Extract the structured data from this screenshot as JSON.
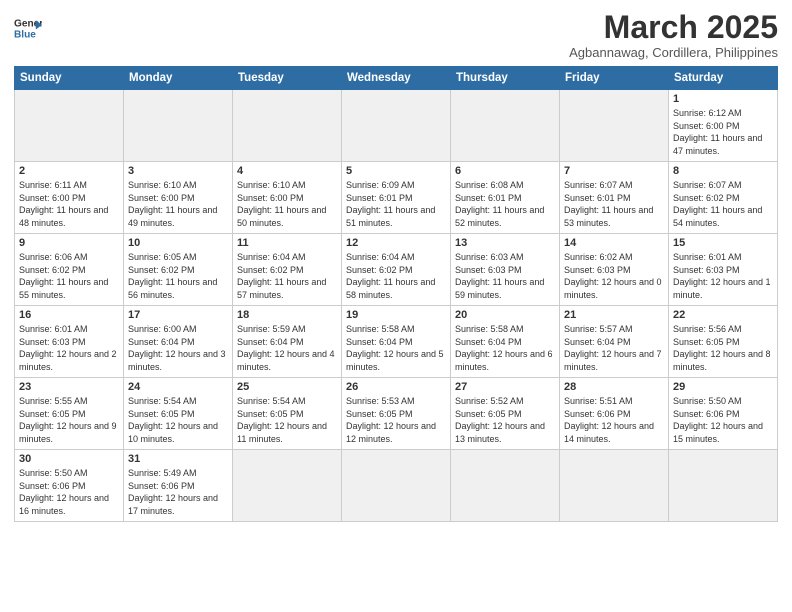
{
  "logo": {
    "line1": "General",
    "line2": "Blue"
  },
  "title": "March 2025",
  "subtitle": "Agbannawag, Cordillera, Philippines",
  "days_of_week": [
    "Sunday",
    "Monday",
    "Tuesday",
    "Wednesday",
    "Thursday",
    "Friday",
    "Saturday"
  ],
  "weeks": [
    [
      {
        "day": "",
        "info": ""
      },
      {
        "day": "",
        "info": ""
      },
      {
        "day": "",
        "info": ""
      },
      {
        "day": "",
        "info": ""
      },
      {
        "day": "",
        "info": ""
      },
      {
        "day": "",
        "info": ""
      },
      {
        "day": "1",
        "info": "Sunrise: 6:12 AM\nSunset: 6:00 PM\nDaylight: 11 hours and 47 minutes."
      }
    ],
    [
      {
        "day": "2",
        "info": "Sunrise: 6:11 AM\nSunset: 6:00 PM\nDaylight: 11 hours and 48 minutes."
      },
      {
        "day": "3",
        "info": "Sunrise: 6:10 AM\nSunset: 6:00 PM\nDaylight: 11 hours and 49 minutes."
      },
      {
        "day": "4",
        "info": "Sunrise: 6:10 AM\nSunset: 6:00 PM\nDaylight: 11 hours and 50 minutes."
      },
      {
        "day": "5",
        "info": "Sunrise: 6:09 AM\nSunset: 6:01 PM\nDaylight: 11 hours and 51 minutes."
      },
      {
        "day": "6",
        "info": "Sunrise: 6:08 AM\nSunset: 6:01 PM\nDaylight: 11 hours and 52 minutes."
      },
      {
        "day": "7",
        "info": "Sunrise: 6:07 AM\nSunset: 6:01 PM\nDaylight: 11 hours and 53 minutes."
      },
      {
        "day": "8",
        "info": "Sunrise: 6:07 AM\nSunset: 6:02 PM\nDaylight: 11 hours and 54 minutes."
      }
    ],
    [
      {
        "day": "9",
        "info": "Sunrise: 6:06 AM\nSunset: 6:02 PM\nDaylight: 11 hours and 55 minutes."
      },
      {
        "day": "10",
        "info": "Sunrise: 6:05 AM\nSunset: 6:02 PM\nDaylight: 11 hours and 56 minutes."
      },
      {
        "day": "11",
        "info": "Sunrise: 6:04 AM\nSunset: 6:02 PM\nDaylight: 11 hours and 57 minutes."
      },
      {
        "day": "12",
        "info": "Sunrise: 6:04 AM\nSunset: 6:02 PM\nDaylight: 11 hours and 58 minutes."
      },
      {
        "day": "13",
        "info": "Sunrise: 6:03 AM\nSunset: 6:03 PM\nDaylight: 11 hours and 59 minutes."
      },
      {
        "day": "14",
        "info": "Sunrise: 6:02 AM\nSunset: 6:03 PM\nDaylight: 12 hours and 0 minutes."
      },
      {
        "day": "15",
        "info": "Sunrise: 6:01 AM\nSunset: 6:03 PM\nDaylight: 12 hours and 1 minute."
      }
    ],
    [
      {
        "day": "16",
        "info": "Sunrise: 6:01 AM\nSunset: 6:03 PM\nDaylight: 12 hours and 2 minutes."
      },
      {
        "day": "17",
        "info": "Sunrise: 6:00 AM\nSunset: 6:04 PM\nDaylight: 12 hours and 3 minutes."
      },
      {
        "day": "18",
        "info": "Sunrise: 5:59 AM\nSunset: 6:04 PM\nDaylight: 12 hours and 4 minutes."
      },
      {
        "day": "19",
        "info": "Sunrise: 5:58 AM\nSunset: 6:04 PM\nDaylight: 12 hours and 5 minutes."
      },
      {
        "day": "20",
        "info": "Sunrise: 5:58 AM\nSunset: 6:04 PM\nDaylight: 12 hours and 6 minutes."
      },
      {
        "day": "21",
        "info": "Sunrise: 5:57 AM\nSunset: 6:04 PM\nDaylight: 12 hours and 7 minutes."
      },
      {
        "day": "22",
        "info": "Sunrise: 5:56 AM\nSunset: 6:05 PM\nDaylight: 12 hours and 8 minutes."
      }
    ],
    [
      {
        "day": "23",
        "info": "Sunrise: 5:55 AM\nSunset: 6:05 PM\nDaylight: 12 hours and 9 minutes."
      },
      {
        "day": "24",
        "info": "Sunrise: 5:54 AM\nSunset: 6:05 PM\nDaylight: 12 hours and 10 minutes."
      },
      {
        "day": "25",
        "info": "Sunrise: 5:54 AM\nSunset: 6:05 PM\nDaylight: 12 hours and 11 minutes."
      },
      {
        "day": "26",
        "info": "Sunrise: 5:53 AM\nSunset: 6:05 PM\nDaylight: 12 hours and 12 minutes."
      },
      {
        "day": "27",
        "info": "Sunrise: 5:52 AM\nSunset: 6:05 PM\nDaylight: 12 hours and 13 minutes."
      },
      {
        "day": "28",
        "info": "Sunrise: 5:51 AM\nSunset: 6:06 PM\nDaylight: 12 hours and 14 minutes."
      },
      {
        "day": "29",
        "info": "Sunrise: 5:50 AM\nSunset: 6:06 PM\nDaylight: 12 hours and 15 minutes."
      }
    ],
    [
      {
        "day": "30",
        "info": "Sunrise: 5:50 AM\nSunset: 6:06 PM\nDaylight: 12 hours and 16 minutes."
      },
      {
        "day": "31",
        "info": "Sunrise: 5:49 AM\nSunset: 6:06 PM\nDaylight: 12 hours and 17 minutes."
      },
      {
        "day": "",
        "info": ""
      },
      {
        "day": "",
        "info": ""
      },
      {
        "day": "",
        "info": ""
      },
      {
        "day": "",
        "info": ""
      },
      {
        "day": "",
        "info": ""
      }
    ]
  ]
}
